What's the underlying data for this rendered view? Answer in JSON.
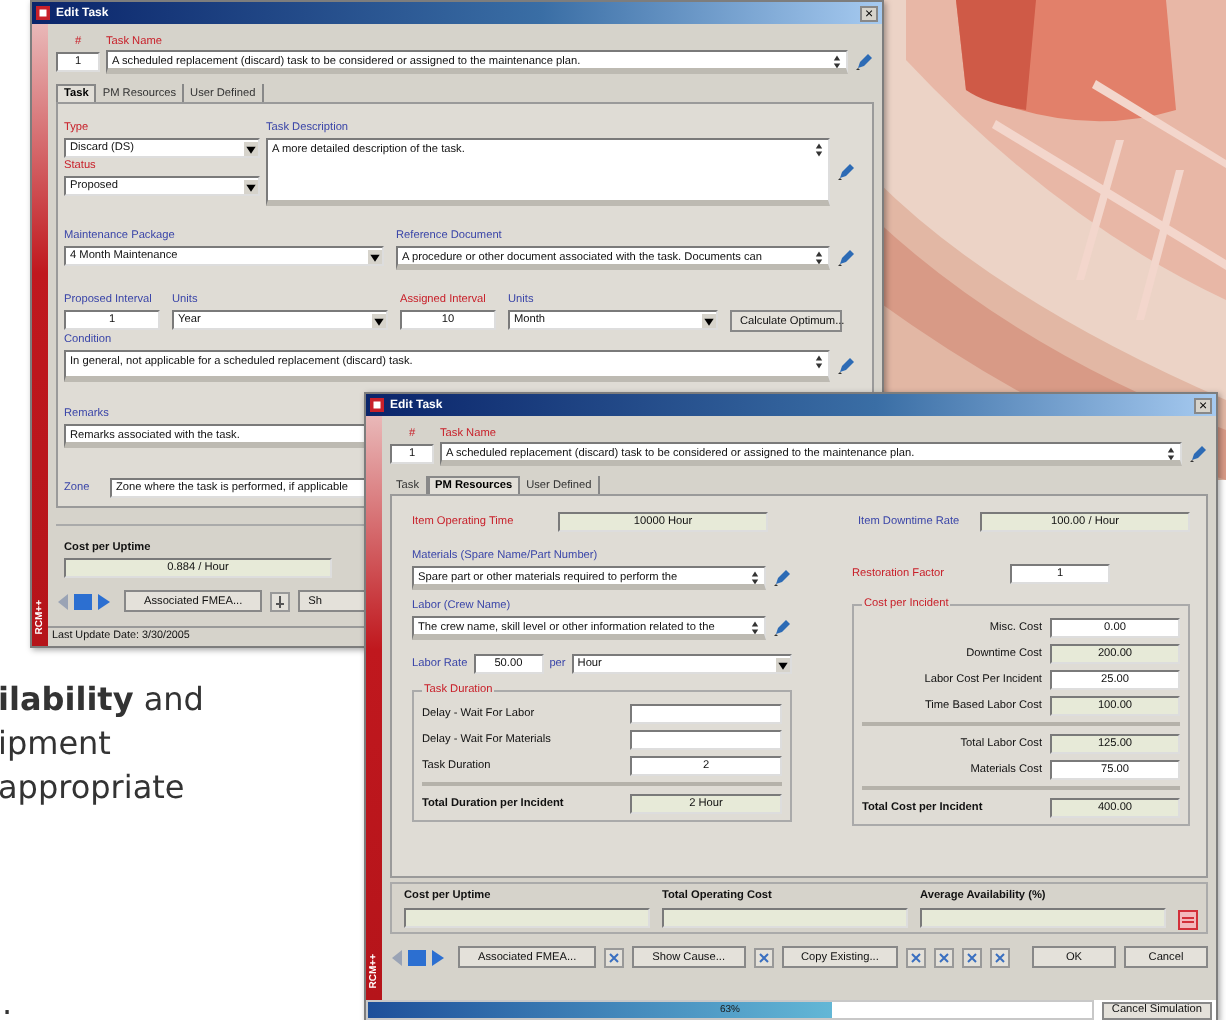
{
  "brochure": {
    "lines": [
      "**ilability** and",
      "ipment",
      "appropriate"
    ],
    "cut_line": "."
  },
  "back_window": {
    "title": "Edit Task",
    "close": "×",
    "brand": "RCM++",
    "number": {
      "label": "#",
      "required": true,
      "value": "1"
    },
    "task_name": {
      "label": "Task Name",
      "required": true,
      "value": "A scheduled replacement (discard) task to be considered or assigned to the maintenance plan."
    },
    "tabs": [
      {
        "label": "Task",
        "selected": true
      },
      {
        "label": "PM Resources",
        "selected": false
      },
      {
        "label": "User Defined",
        "selected": false
      }
    ],
    "type": {
      "label": "Type",
      "required": true,
      "value": "Discard (DS)"
    },
    "status": {
      "label": "Status",
      "required": true,
      "value": "Proposed"
    },
    "description": {
      "label": "Task Description",
      "required": false,
      "value": "A more detailed description of the task."
    },
    "package": {
      "label": "Maintenance Package",
      "required": false,
      "value": "4 Month Maintenance"
    },
    "reference": {
      "label": "Reference Document",
      "required": false,
      "value": "A procedure or other document associated with the task. Documents can"
    },
    "proposed_interval": {
      "label": "Proposed Interval",
      "required": false,
      "value": "1"
    },
    "proposed_units": {
      "label": "Units",
      "required": false,
      "value": "Year"
    },
    "assigned_interval": {
      "label": "Assigned Interval",
      "required": true,
      "value": "10"
    },
    "assigned_units": {
      "label": "Units",
      "required": false,
      "value": "Month"
    },
    "calculate_button": "Calculate Optimum...",
    "condition": {
      "label": "Condition",
      "required": false,
      "value": "In general, not applicable for a scheduled replacement (discard) task."
    },
    "remarks": {
      "label": "Remarks",
      "required": false,
      "value": "Remarks associated with the task."
    },
    "zone": {
      "label": "Zone",
      "required": false,
      "value": "Zone where the task is performed, if applicable"
    },
    "cost_per_uptime": {
      "label": "Cost per Uptime",
      "value": "0.884 / Hour"
    },
    "buttons": [
      "Associated FMEA...",
      "Sh"
    ],
    "status_bar": "Last Update Date: 3/30/2005"
  },
  "front_window": {
    "title": "Edit Task",
    "close": "×",
    "brand": "RCM++",
    "number": {
      "label": "#",
      "required": true,
      "value": "1"
    },
    "task_name": {
      "label": "Task Name",
      "required": true,
      "value": "A scheduled replacement (discard) task to be considered or assigned to the maintenance plan."
    },
    "tabs": [
      {
        "label": "Task",
        "selected": false
      },
      {
        "label": "PM Resources",
        "selected": true
      },
      {
        "label": "User Defined",
        "selected": false
      }
    ],
    "operating_time": {
      "label": "Item Operating Time",
      "required": true,
      "value": "10000 Hour"
    },
    "downtime_rate": {
      "label": "Item Downtime Rate",
      "required": false,
      "value": "100.00 / Hour"
    },
    "materials": {
      "label": "Materials (Spare Name/Part Number)",
      "required": false,
      "value": "Spare part or other materials required to perform the"
    },
    "labor": {
      "label": "Labor (Crew Name)",
      "required": false,
      "value": "The crew name, skill level or other information related to the"
    },
    "labor_rate": {
      "label": "Labor Rate",
      "required": false,
      "value": "50.00"
    },
    "rate_per": {
      "label": "per",
      "required": false,
      "value": "Hour"
    },
    "restoration_factor": {
      "label": "Restoration Factor",
      "required": true,
      "value": "1"
    },
    "task_duration": {
      "title": "Task Duration",
      "rows": [
        {
          "label": "Delay - Wait For Labor",
          "kind": "input"
        },
        {
          "label": "Delay - Wait For Materials",
          "kind": "input"
        },
        {
          "label": "Task Duration",
          "value": "2",
          "kind": "input"
        },
        {
          "label": "Total Duration per Incident",
          "value": "2 Hour",
          "kind": "total"
        }
      ]
    },
    "cost_per_incident": {
      "title": "Cost per Incident",
      "rows": [
        {
          "label": "Misc. Cost",
          "value": "0.00",
          "kind": "input"
        },
        {
          "label": "Downtime Cost",
          "value": "200.00",
          "kind": "computed"
        },
        {
          "label": "Labor Cost Per Incident",
          "value": "25.00",
          "kind": "input"
        },
        {
          "label": "Time Based Labor Cost",
          "value": "100.00",
          "kind": "computed"
        },
        {
          "label": "Total Labor Cost",
          "value": "125.00",
          "kind": "subtotal"
        },
        {
          "label": "Materials Cost",
          "value": "75.00",
          "kind": "input"
        },
        {
          "label": "Total Cost per Incident",
          "value": "400.00",
          "kind": "total"
        }
      ]
    },
    "results": [
      {
        "label": "Cost per Uptime"
      },
      {
        "label": "Total Operating Cost"
      },
      {
        "label": "Average Availability (%)"
      }
    ],
    "buttons": [
      {
        "kind": "text",
        "label": "Associated FMEA..."
      },
      {
        "kind": "icon"
      },
      {
        "kind": "text",
        "label": "Show Cause..."
      },
      {
        "kind": "icon"
      },
      {
        "kind": "text",
        "label": "Copy Existing..."
      },
      {
        "kind": "icon"
      },
      {
        "kind": "icon"
      },
      {
        "kind": "icon"
      },
      {
        "kind": "icon"
      }
    ],
    "ok": "OK",
    "cancel": "Cancel",
    "progress": {
      "level": 0.64,
      "text": "63%"
    },
    "cancel_simulation": "Cancel Simulation"
  }
}
